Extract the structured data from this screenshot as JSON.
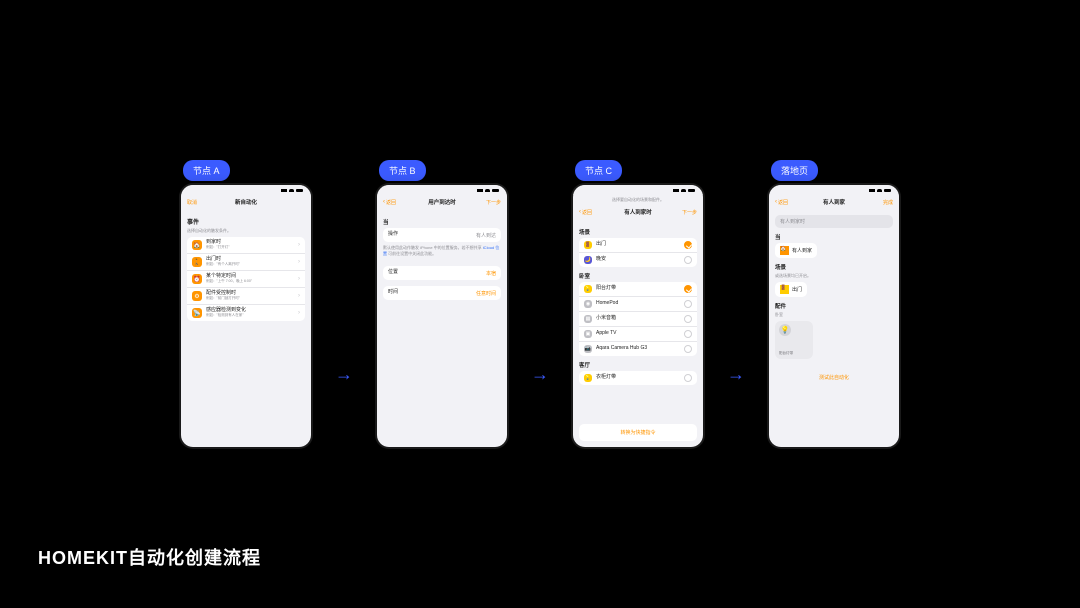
{
  "caption": "HOMEKIT自动化创建流程",
  "badges": {
    "a": "节点 A",
    "b": "节点 B",
    "c": "节点 C",
    "d": "落地页"
  },
  "arrow": "→",
  "screenA": {
    "nav": {
      "left": "取消",
      "title": "新自动化",
      "right": ""
    },
    "section": {
      "title": "事件",
      "sub": "选择自动化的触发条件。"
    },
    "rows": [
      {
        "icon": "🏠",
        "t1": "到家时",
        "t2": "例如：\"打开灯\""
      },
      {
        "icon": "🚶",
        "t1": "出门时",
        "t2": "例如：\"有个人离开时\""
      },
      {
        "icon": "⏰",
        "t1": "某个特定时间",
        "t2": "例如：\"上午 7:00，晚上 6:00\""
      },
      {
        "icon": "⚙",
        "t1": "配件受控制时",
        "t2": "例如：\"前门锁打开时\""
      },
      {
        "icon": "📡",
        "t1": "感应器检测到变化",
        "t2": "例如：\"检测到有人在家\""
      }
    ]
  },
  "screenB": {
    "nav": {
      "left": "返回",
      "title": "用户到达时",
      "right": "下一步"
    },
    "when": "当",
    "rowAction": {
      "label": "操作",
      "value": "有人到达"
    },
    "note_pre": "默认使用此动作触发 iPhone 中的位置服务。若不想共享 ",
    "note_link": "iCloud 位置",
    "note_post": " 可前往设置中关闭此功能。",
    "rowLoc": {
      "label": "位置",
      "value": "本宿"
    },
    "rowTime": {
      "label": "时间",
      "value": "任意时间"
    }
  },
  "screenC": {
    "micro": "选择要自动化的场景和配件。",
    "nav": {
      "left": "返回",
      "title": "有人到家时",
      "right": "下一步"
    },
    "groups": {
      "scenes": {
        "label": "场景",
        "items": [
          {
            "icon": "🚪",
            "name": "出门",
            "on": true
          },
          {
            "icon": "🌙",
            "name": "晚安",
            "on": false
          }
        ]
      },
      "bedroom": {
        "label": "卧室",
        "items": [
          {
            "icon": "💡",
            "name": "阳台灯带",
            "on": true
          },
          {
            "icon": "◉",
            "name": "HomePod",
            "on": false
          },
          {
            "icon": "▦",
            "name": "小米音箱",
            "on": false
          },
          {
            "icon": "▣",
            "name": "Apple TV",
            "on": false
          },
          {
            "icon": "📷",
            "name": "Aqara Camera Hub G3",
            "on": false
          }
        ]
      },
      "living": {
        "label": "客厅",
        "items": [
          {
            "icon": "💡",
            "name": "衣柜灯带",
            "on": false
          }
        ]
      }
    },
    "cta": "转换为快捷指令"
  },
  "screenD": {
    "nav": {
      "left": "返回",
      "title": "有人到家",
      "right": "完成"
    },
    "search_placeholder": "有人到家时",
    "when": "当",
    "whenChip": {
      "icon": "🏠",
      "label": "有人到家"
    },
    "scenes": {
      "label": "场景",
      "sub": "或选场景均已开启。",
      "chip": {
        "icon": "🚪",
        "label": "出门"
      }
    },
    "acc": {
      "label": "配件",
      "sub": "卧室",
      "tile": {
        "icon": "💡",
        "label": "阳台灯带"
      }
    },
    "cta": "测试此自动化"
  }
}
